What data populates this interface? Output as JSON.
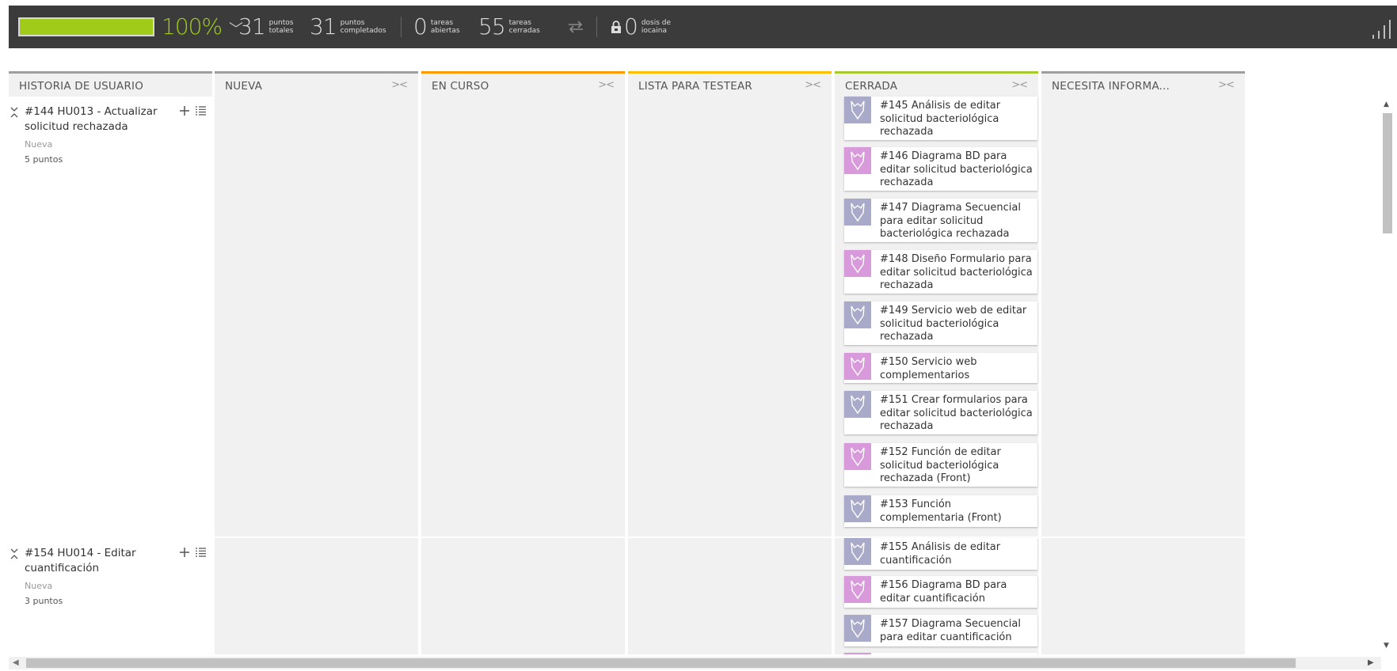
{
  "stats": {
    "progress_percent": 100,
    "percent_text": "100%",
    "total_points": "31",
    "total_points_label": "puntos\ntotales",
    "completed_points": "31",
    "completed_points_label": "puntos\ncompletados",
    "open_tasks": "0",
    "open_tasks_label": "tareas\nabiertas",
    "closed_tasks": "55",
    "closed_tasks_label": "tareas\ncerradas",
    "iocaine": "0",
    "iocaine_label": "dosis de\niocaina"
  },
  "columns": [
    {
      "title": "HISTORIA DE USUARIO",
      "color": "#9e9e9e"
    },
    {
      "title": "NUEVA",
      "color": "#9e9e9e"
    },
    {
      "title": "EN CURSO",
      "color": "#ff9900"
    },
    {
      "title": "LISTA PARA TESTEAR",
      "color": "#fcc000"
    },
    {
      "title": "CERRADA",
      "color": "#a8c832"
    },
    {
      "title": "NECESITA INFORMA...",
      "color": "#9e9e9e"
    }
  ],
  "collapse_symbol": "><",
  "stories": [
    {
      "title": "#144 HU013 - Actualizar solicitud rechazada",
      "status": "Nueva",
      "points": "5 puntos"
    },
    {
      "title": "#154 HU014 - Editar cuantificación",
      "status": "Nueva",
      "points": "3 puntos"
    }
  ],
  "cards": [
    {
      "text": "#145 Análisis de editar solicitud bacteriológica rechazada",
      "avatar": "gray"
    },
    {
      "text": "#146 Diagrama BD para editar solicitud bacteriológica rechazada",
      "avatar": "pink"
    },
    {
      "text": "#147 Diagrama Secuencial para editar solicitud bacteriológica rechazada",
      "avatar": "gray"
    },
    {
      "text": "#148 Diseño Formulario para editar solicitud bacteriológica rechazada",
      "avatar": "pink"
    },
    {
      "text": "#149 Servicio web de editar solicitud bacteriológica rechazada",
      "avatar": "gray"
    },
    {
      "text": "#150 Servicio web complementarios",
      "avatar": "pink"
    },
    {
      "text": "#151 Crear formularios para editar solicitud bacteriológica rechazada",
      "avatar": "gray"
    },
    {
      "text": "#152 Función de editar solicitud bacteriológica rechazada (Front)",
      "avatar": "pink"
    },
    {
      "text": "#153 Función complementaria (Front)",
      "avatar": "gray"
    },
    {
      "text": "#155 Análisis de editar cuantificación",
      "avatar": "gray"
    },
    {
      "text": "#156  Diagrama BD para editar cuantificación",
      "avatar": "pink"
    },
    {
      "text": "#157 Diagrama Secuencial para editar cuantificación",
      "avatar": "gray"
    }
  ],
  "colors": {
    "avatar_gray": "#a9a9c9",
    "avatar_pink": "#d99adb",
    "topbar": "#3b3b3b",
    "progress": "#a0cc19"
  }
}
